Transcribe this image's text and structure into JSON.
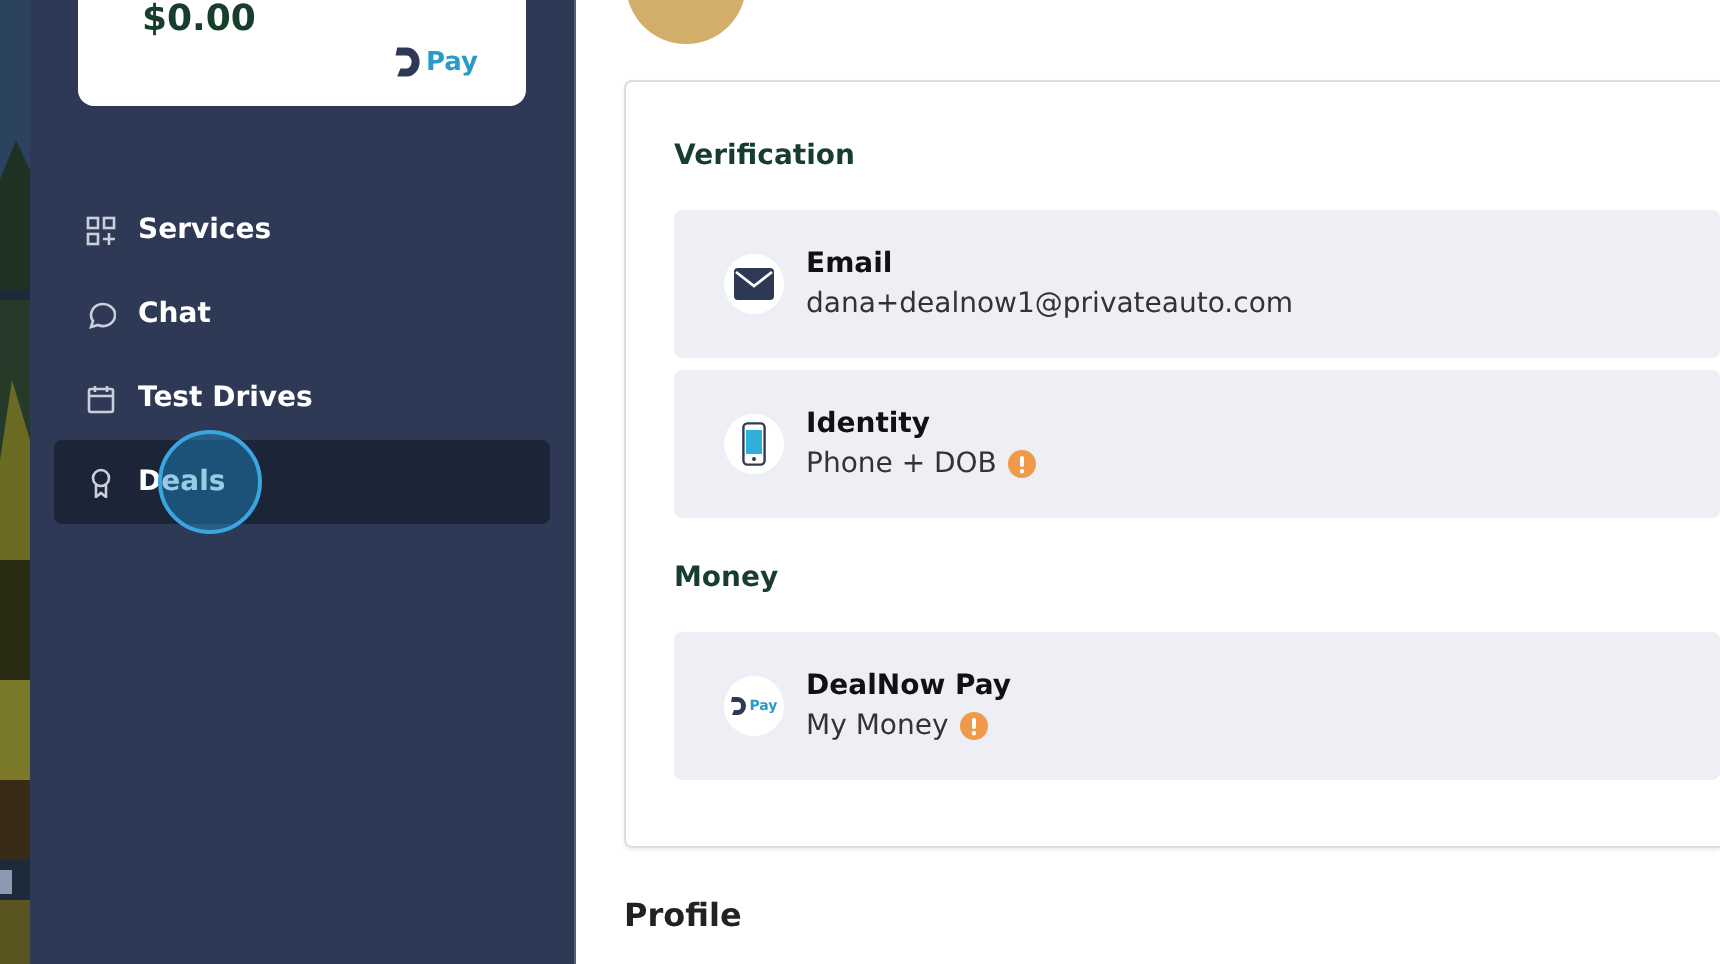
{
  "sidebar": {
    "balance_card": {
      "amount": "$0.00",
      "logo_text": "Pay"
    },
    "items": [
      {
        "label": "Services",
        "kind": "grid",
        "selected": false,
        "clicked": false
      },
      {
        "label": "Chat",
        "kind": "chat",
        "selected": false,
        "clicked": false
      },
      {
        "label": "Test Drives",
        "kind": "calendar",
        "selected": false,
        "clicked": false
      },
      {
        "label": "Deals",
        "kind": "ribbon",
        "selected": true,
        "clicked": true
      }
    ]
  },
  "main": {
    "sections": [
      {
        "title": "Verification",
        "rows": [
          {
            "kind": "mail",
            "title": "Email",
            "detail": "dana+dealnow1@privateauto.com",
            "warning": false
          },
          {
            "kind": "phone",
            "title": "Identity",
            "detail": "Phone + DOB",
            "warning": true
          }
        ]
      },
      {
        "title": "Money",
        "rows": [
          {
            "kind": "pay",
            "icon_text": "Pay",
            "title": "DealNow Pay",
            "detail": "My Money",
            "warning": true
          }
        ]
      }
    ],
    "footer_heading": "Profile"
  }
}
